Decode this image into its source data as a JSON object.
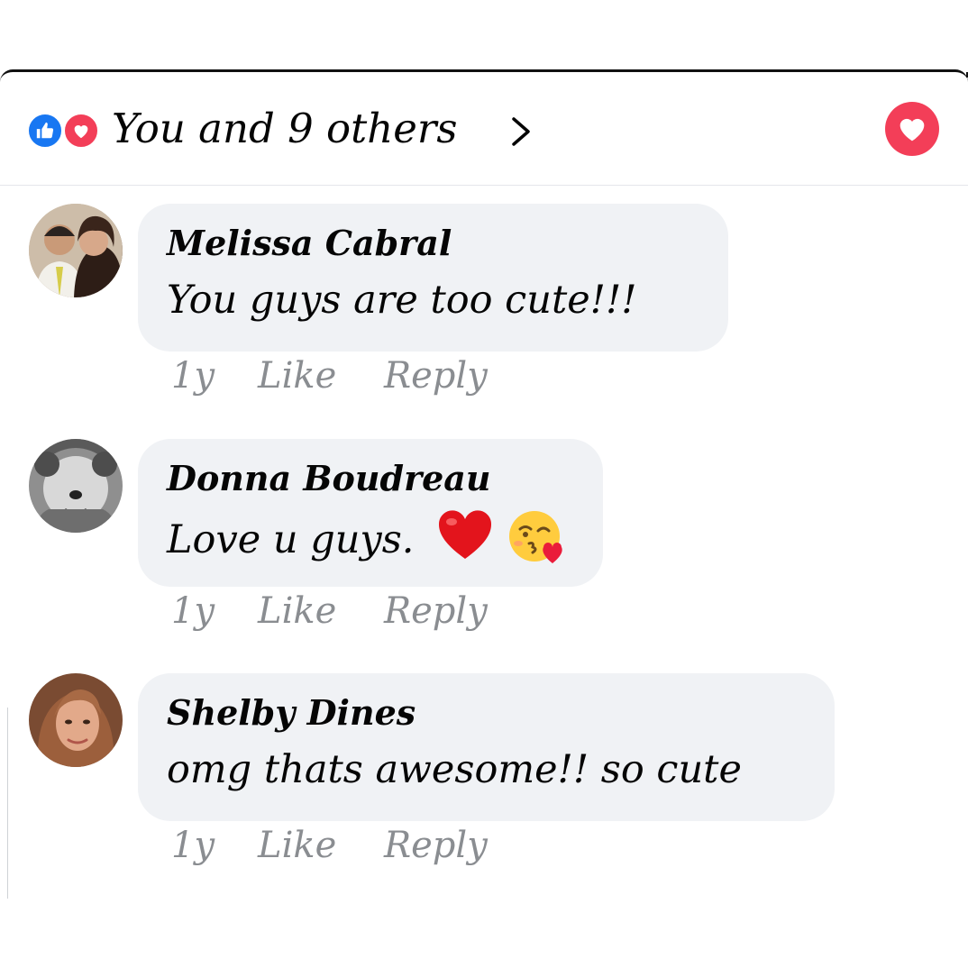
{
  "header": {
    "reaction_icons": [
      "like-icon",
      "love-icon"
    ],
    "summary": "You and 9 others",
    "chevron": "chevron-right-icon",
    "love_button_icon": "heart-icon"
  },
  "colors": {
    "like_blue": "#1877f2",
    "love_red": "#f33e58",
    "bubble_bg": "#f0f2f5",
    "meta_gray": "#8a8d91"
  },
  "comments": [
    {
      "author": "Melissa Cabral",
      "text": "You guys are too cute!!!",
      "time": "1y",
      "like_label": "Like",
      "reply_label": "Reply"
    },
    {
      "author": "Donna Boudreau",
      "text": "Love u guys.",
      "emojis": [
        "red-heart-emoji",
        "face-blowing-kiss-emoji"
      ],
      "time": "1y",
      "like_label": "Like",
      "reply_label": "Reply"
    },
    {
      "author": "Shelby Dines",
      "text": "omg thats awesome!! so cute",
      "time": "1y",
      "like_label": "Like",
      "reply_label": "Reply"
    }
  ]
}
